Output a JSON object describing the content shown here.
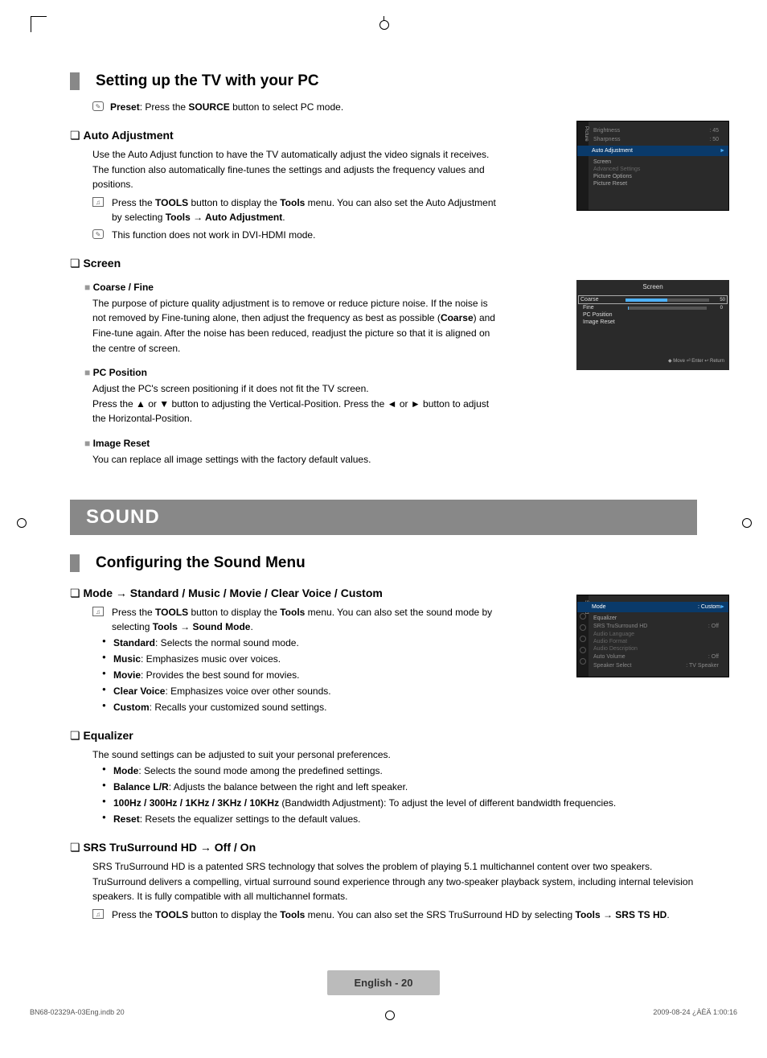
{
  "section1": {
    "title": "Setting up the TV with your PC",
    "preset_note_a": "Preset",
    "preset_note_b": ": Press the ",
    "preset_note_c": "SOURCE",
    "preset_note_d": " button to select PC mode.",
    "auto_adj": {
      "heading": "Auto Adjustment",
      "body": "Use the Auto Adjust function to have the TV automatically adjust the video signals it receives. The function also automatically fine-tunes the settings and adjusts the frequency values and positions.",
      "tool_a": "Press the ",
      "tool_b": "TOOLS",
      "tool_c": " button to display the ",
      "tool_d": "Tools",
      "tool_e": " menu. You can also set the Auto Adjustment by selecting ",
      "tool_f": "Tools → Auto Adjustment",
      "tool_g": ".",
      "note2": "This function does not work in DVI-HDMI mode."
    },
    "screen": {
      "heading": "Screen",
      "coarse_fine_h": "Coarse / Fine",
      "coarse_fine_b1": "The purpose of picture quality adjustment is to remove or reduce picture noise. If the noise is not removed by Fine-tuning alone, then adjust the frequency as best as possible (",
      "coarse_fine_b1b": "Coarse",
      "coarse_fine_b1c": ") and Fine-tune again. After the noise has been reduced, readjust the picture so that it is aligned on the centre of screen.",
      "pc_pos_h": "PC Position",
      "pc_pos_b1": "Adjust the PC's screen positioning if it does not fit the TV screen.",
      "pc_pos_b2": "Press the ▲ or ▼ button to adjusting the Vertical-Position. Press the ◄ or ► button to adjust the Horizontal-Position.",
      "img_reset_h": "Image Reset",
      "img_reset_b": "You can replace all image settings with the factory default values."
    }
  },
  "osd1": {
    "tab": "Picture",
    "brightness": "Brightness",
    "brightness_v": ": 45",
    "sharpness": "Sharpness",
    "sharpness_v": ": 50",
    "auto": "Auto Adjustment",
    "screen": "Screen",
    "adv": "Advanced Settings",
    "popt": "Picture Options",
    "preset": "Picture Reset"
  },
  "osd2": {
    "title": "Screen",
    "coarse": "Coarse",
    "coarse_v": "50",
    "fine": "Fine",
    "fine_v": "0",
    "pcpos": "PC Position",
    "imgreset": "Image Reset",
    "foot": "◆ Move    ⏎ Enter    ↩ Return"
  },
  "sound_bar": "SOUND",
  "section2": {
    "title": "Configuring the Sound Menu",
    "mode_h": "Mode → Standard / Music / Movie / Clear Voice / Custom",
    "mode_tool_a": "Press the ",
    "mode_tool_b": "TOOLS",
    "mode_tool_c": " button to display the ",
    "mode_tool_d": "Tools",
    "mode_tool_e": " menu. You can also set the sound mode by selecting ",
    "mode_tool_f": "Tools → Sound Mode",
    "mode_tool_g": ".",
    "b_std_a": "Standard",
    "b_std_b": ": Selects the normal sound mode.",
    "b_mus_a": "Music",
    "b_mus_b": ": Emphasizes music over voices.",
    "b_mov_a": "Movie",
    "b_mov_b": ": Provides the best sound for movies.",
    "b_cv_a": "Clear Voice",
    "b_cv_b": ": Emphasizes voice over other sounds.",
    "b_cu_a": "Custom",
    "b_cu_b": ": Recalls your customized sound settings.",
    "eq_h": "Equalizer",
    "eq_body": "The sound settings can be adjusted to suit your personal preferences.",
    "eq_b1a": "Mode",
    "eq_b1b": ": Selects the sound mode among the predefined settings.",
    "eq_b2a": "Balance L/R",
    "eq_b2b": ": Adjusts the balance between the right and left speaker.",
    "eq_b3a": "100Hz / 300Hz / 1KHz / 3KHz / 10KHz",
    "eq_b3b": " (Bandwidth Adjustment): To adjust the level of different bandwidth frequencies.",
    "eq_b4a": "Reset",
    "eq_b4b": ": Resets the equalizer settings to the default values.",
    "srs_h": "SRS TruSurround HD → Off / On",
    "srs_body": "SRS TruSurround HD is a patented SRS technology that solves the problem of playing 5.1 multichannel content over two speakers. TruSurround delivers a compelling, virtual surround sound experience through any two-speaker playback system, including internal television speakers. It is fully compatible with all multichannel formats.",
    "srs_tool_a": "Press the ",
    "srs_tool_b": "TOOLS",
    "srs_tool_c": " button to display the ",
    "srs_tool_d": "Tools",
    "srs_tool_e": " menu. You can also set the SRS TruSurround HD by selecting ",
    "srs_tool_f": "Tools → SRS TS HD",
    "srs_tool_g": "."
  },
  "osd3": {
    "tab": "Sound",
    "mode": "Mode",
    "mode_v": ": Custom",
    "eq": "Equalizer",
    "srs": "SRS TruSurround HD",
    "srs_v": ": Off",
    "al": "Audio Language",
    "af": "Audio Format",
    "ad": "Audio Description",
    "av": "Auto Volume",
    "av_v": ": Off",
    "ss": "Speaker Select",
    "ss_v": ": TV Speaker"
  },
  "footer": "English - 20",
  "bottom_l": "BN68-02329A-03Eng.indb   20",
  "bottom_r": "2009-08-24   ¿ÀÈÄ 1:00:16"
}
